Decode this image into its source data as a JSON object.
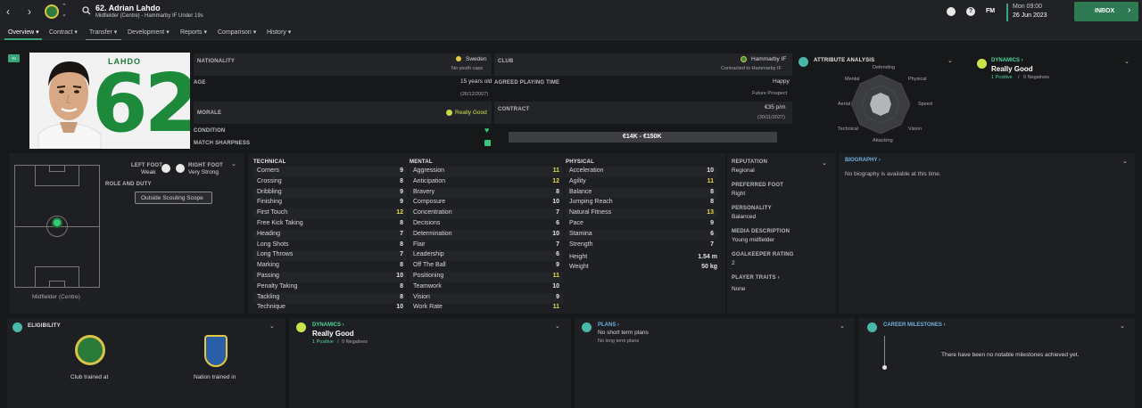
{
  "header": {
    "player_title": "62. Adrian Lahdo",
    "player_subtitle": "Midfielder (Centre) - Hammarby IF Under 19s",
    "fm_label": "FM",
    "time": "Mon 09:00",
    "date": "26 Jun 2023",
    "inbox_label": "INBOX"
  },
  "menu": {
    "overview": "Overview",
    "contract": "Contract",
    "transfer": "Transfer",
    "development": "Development",
    "reports": "Reports",
    "comparison": "Comparison",
    "history": "History"
  },
  "profile": {
    "badge": "Yo",
    "shirt_name": "LAHDO",
    "shirt_number": "62",
    "nationality_label": "NATIONALITY",
    "nationality": "Sweden",
    "youth_caps": "No youth caps",
    "age_label": "AGE",
    "age": "15 years old",
    "dob": "(26/12/2007)",
    "morale_label": "MORALE",
    "morale": "Really Good",
    "condition_label": "CONDITION",
    "sharpness_label": "MATCH SHARPNESS",
    "club_label": "CLUB",
    "club": "Hammarby IF",
    "club_contract": "Contracted to Hammarby IF",
    "playing_time_label": "AGREED PLAYING TIME",
    "happy": "Happy",
    "playing_time": "Future Prospect",
    "contract_label": "CONTRACT",
    "wage": "€35 p/m",
    "contract_end": "(30/11/2027)",
    "value_range": "€14K - €150K"
  },
  "attr_analysis": {
    "title": "ATTRIBUTE ANALYSIS",
    "labels": {
      "defending": "Defending",
      "physical": "Physical",
      "speed": "Speed",
      "vision": "Vision",
      "attacking": "Attacking",
      "technical": "Technical",
      "aerial": "Aerial",
      "mental": "Mental"
    }
  },
  "dynamics_top": {
    "title": "DYNAMICS",
    "value": "Really Good",
    "positives": "1 Positive",
    "sep": "/",
    "negatives": "0 Negatives"
  },
  "position": {
    "left_foot_label": "LEFT FOOT",
    "left_foot": "Weak",
    "right_foot_label": "RIGHT FOOT",
    "right_foot": "Very Strong",
    "role_label": "ROLE AND DUTY",
    "scouting_button": "Outside Scouting Scope",
    "position_name": "Midfielder (Centre)"
  },
  "attributes": {
    "technical_title": "TECHNICAL",
    "mental_title": "MENTAL",
    "physical_title": "PHYSICAL",
    "technical": [
      {
        "name": "Corners",
        "value": "9",
        "hi": false
      },
      {
        "name": "Crossing",
        "value": "8",
        "hi": false
      },
      {
        "name": "Dribbling",
        "value": "9",
        "hi": false
      },
      {
        "name": "Finishing",
        "value": "9",
        "hi": false
      },
      {
        "name": "First Touch",
        "value": "12",
        "hi": true
      },
      {
        "name": "Free Kick Taking",
        "value": "8",
        "hi": false
      },
      {
        "name": "Heading",
        "value": "7",
        "hi": false
      },
      {
        "name": "Long Shots",
        "value": "8",
        "hi": false
      },
      {
        "name": "Long Throws",
        "value": "7",
        "hi": false
      },
      {
        "name": "Marking",
        "value": "8",
        "hi": false
      },
      {
        "name": "Passing",
        "value": "10",
        "hi": false
      },
      {
        "name": "Penalty Taking",
        "value": "8",
        "hi": false
      },
      {
        "name": "Tackling",
        "value": "8",
        "hi": false
      },
      {
        "name": "Technique",
        "value": "10",
        "hi": false
      }
    ],
    "mental": [
      {
        "name": "Aggression",
        "value": "11",
        "hi": true
      },
      {
        "name": "Anticipation",
        "value": "12",
        "hi": true
      },
      {
        "name": "Bravery",
        "value": "8",
        "hi": false
      },
      {
        "name": "Composure",
        "value": "10",
        "hi": false
      },
      {
        "name": "Concentration",
        "value": "7",
        "hi": false
      },
      {
        "name": "Decisions",
        "value": "6",
        "hi": false
      },
      {
        "name": "Determination",
        "value": "10",
        "hi": false
      },
      {
        "name": "Flair",
        "value": "7",
        "hi": false
      },
      {
        "name": "Leadership",
        "value": "6",
        "hi": false
      },
      {
        "name": "Off The Ball",
        "value": "9",
        "hi": false
      },
      {
        "name": "Positioning",
        "value": "11",
        "hi": true
      },
      {
        "name": "Teamwork",
        "value": "10",
        "hi": false
      },
      {
        "name": "Vision",
        "value": "9",
        "hi": false
      },
      {
        "name": "Work Rate",
        "value": "11",
        "hi": true
      }
    ],
    "physical": [
      {
        "name": "Acceleration",
        "value": "10",
        "hi": false
      },
      {
        "name": "Agility",
        "value": "11",
        "hi": true
      },
      {
        "name": "Balance",
        "value": "8",
        "hi": false
      },
      {
        "name": "Jumping Reach",
        "value": "8",
        "hi": false
      },
      {
        "name": "Natural Fitness",
        "value": "13",
        "hi": true
      },
      {
        "name": "Pace",
        "value": "9",
        "hi": false
      },
      {
        "name": "Stamina",
        "value": "6",
        "hi": false
      },
      {
        "name": "Strength",
        "value": "7",
        "hi": false
      }
    ],
    "height_label": "Height",
    "height": "1.54 m",
    "weight_label": "Weight",
    "weight": "50 kg"
  },
  "info": {
    "reputation_label": "REPUTATION",
    "reputation": "Regional",
    "foot_label": "PREFERRED FOOT",
    "foot": "Right",
    "personality_label": "PERSONALITY",
    "personality": "Balanced",
    "media_label": "MEDIA DESCRIPTION",
    "media": "Young midfielder",
    "gk_label": "GOALKEEPER RATING",
    "gk": "2",
    "traits_label": "PLAYER TRAITS",
    "traits": "None"
  },
  "biography": {
    "title": "BIOGRAPHY",
    "text": "No biography is available at this time."
  },
  "bottom": {
    "eligibility_title": "ELIGIBILITY",
    "club_trained": "Club trained at",
    "nation_trained": "Nation trained in",
    "dynamics_title": "DYNAMICS",
    "dynamics_value": "Really Good",
    "positives": "1 Positive",
    "sep": "/",
    "negatives": "0 Negatives",
    "plans_title": "PLANS",
    "short_plans": "No short term plans",
    "long_plans": "No long term plans",
    "milestones_title": "CAREER MILESTONES",
    "milestones_text": "There have been no notable milestones achieved yet."
  },
  "colors": {
    "accent_green": "#3aa57a",
    "highlight_yellow": "#e6d84a",
    "inbox_green": "#2e7a52"
  }
}
